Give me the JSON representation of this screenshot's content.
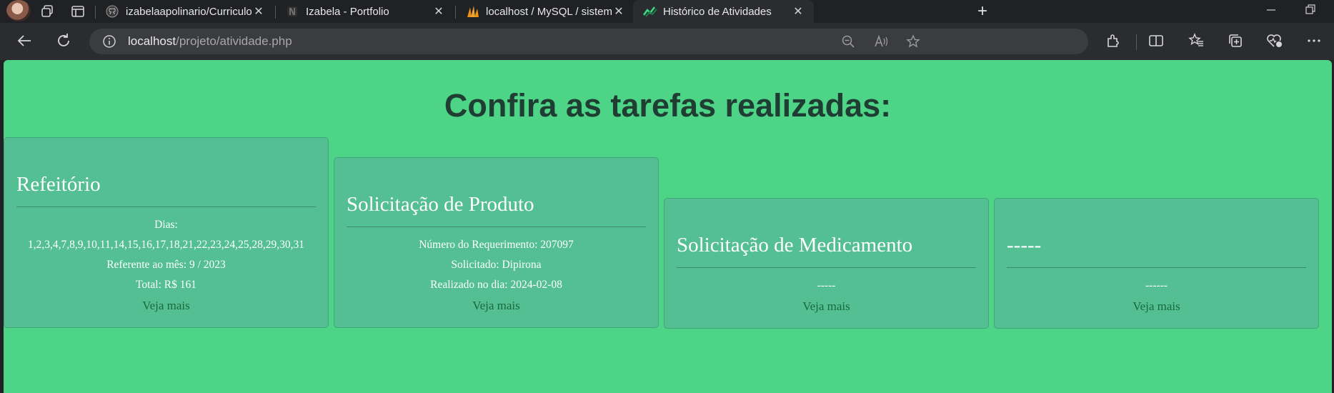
{
  "browser": {
    "tabs": [
      {
        "title": "izabelaapolinario/Curriculo",
        "active": false
      },
      {
        "title": "Izabela - Portfolio",
        "active": false
      },
      {
        "title": "localhost / MySQL / sistemanacj",
        "active": false
      },
      {
        "title": "Histórico de Atividades",
        "active": true
      }
    ],
    "new_tab": "+",
    "address": {
      "host": "localhost",
      "path": "/projeto/atividade.php"
    }
  },
  "page": {
    "heading": "Confira as tarefas realizadas:",
    "cards": [
      {
        "title": "Refeitório",
        "lines": [
          "Dias:",
          "1,2,3,4,7,8,9,10,11,14,15,16,17,18,21,22,23,24,25,28,29,30,31",
          "Referente ao mês: 9 / 2023",
          "Total: R$ 161"
        ],
        "link": "Veja mais"
      },
      {
        "title": "Solicitação de Produto",
        "lines": [
          "Número do Requerimento: 207097",
          "Solicitado: Dipirona",
          "Realizado no dia: 2024-02-08"
        ],
        "link": "Veja mais"
      },
      {
        "title": "Solicitação de Medicamento",
        "lines": [
          "-----"
        ],
        "link": "Veja mais"
      },
      {
        "title": "-----",
        "lines": [
          "------"
        ],
        "link": "Veja mais"
      }
    ]
  }
}
